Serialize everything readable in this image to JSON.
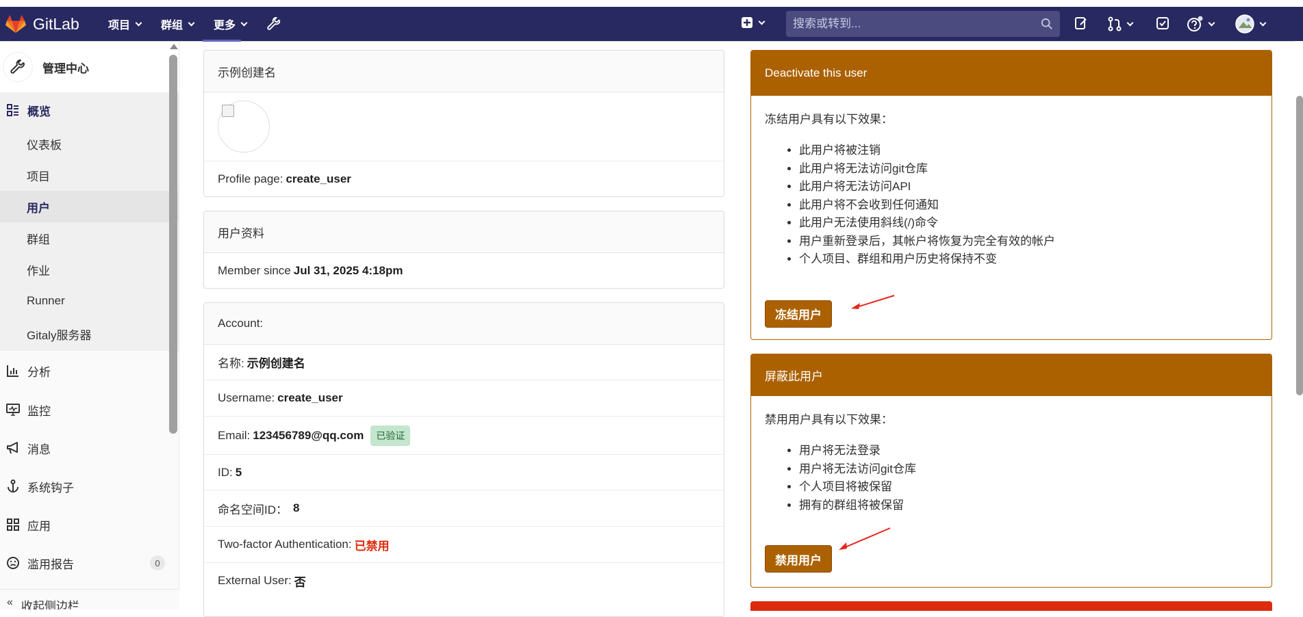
{
  "nav": {
    "brand": "GitLab",
    "menu": [
      "项目",
      "群组",
      "更多"
    ],
    "search_placeholder": "搜索或转到..."
  },
  "sidebar": {
    "title": "管理中心",
    "overview": "概览",
    "overview_items": [
      "仪表板",
      "项目",
      "用户",
      "群组",
      "作业",
      "Runner",
      "Gitaly服务器"
    ],
    "active_item": "用户",
    "items": [
      {
        "label": "分析",
        "icon": "chart-icon"
      },
      {
        "label": "监控",
        "icon": "monitor-icon"
      },
      {
        "label": "消息",
        "icon": "megaphone-icon"
      },
      {
        "label": "系统钩子",
        "icon": "anchor-icon"
      },
      {
        "label": "应用",
        "icon": "apps-icon"
      },
      {
        "label": "滥用报告",
        "icon": "smiley-icon",
        "badge": "0"
      }
    ],
    "collapse": "收起侧边栏"
  },
  "profile_card": {
    "header": "示例创建名",
    "profile_label": "Profile page:",
    "profile_value": "create_user"
  },
  "info_card": {
    "header": "用户资料",
    "member_label": "Member since",
    "member_value": "Jul 31, 2025 4:18pm"
  },
  "account_card": {
    "header": "Account:",
    "name_label": "名称:",
    "name_value": "示例创建名",
    "username_label": "Username:",
    "username_value": "create_user",
    "email_label": "Email:",
    "email_value": "123456789@qq.com",
    "verified": "已验证",
    "id_label": "ID:",
    "id_value": "5",
    "ns_label": "命名空间ID：",
    "ns_value": "8",
    "tfa_label": "Two-factor Authentication:",
    "tfa_value": "已禁用",
    "ext_label": "External User:",
    "ext_value": "否"
  },
  "deactivate_card": {
    "header": "Deactivate this user",
    "intro": "冻结用户具有以下效果：",
    "effects": [
      "此用户将被注销",
      "此用户将无法访问git仓库",
      "此用户将无法访问API",
      "此用户将不会收到任何通知",
      "此用户无法使用斜线(/)命令",
      "用户重新登录后，其帐户将恢复为完全有效的帐户",
      "个人项目、群组和用户历史将保持不变"
    ],
    "button": "冻结用户"
  },
  "block_card": {
    "header": "屏蔽此用户",
    "intro": "禁用用户具有以下效果：",
    "effects": [
      "用户将无法登录",
      "用户将无法访问git仓库",
      "个人项目将被保留",
      "拥有的群组将被保留"
    ],
    "button": "禁用用户"
  },
  "colors": {
    "navbar": "#292961",
    "warning": "#ab6100",
    "danger": "#dd2b0e",
    "annotation_arrow": "#e8261b"
  }
}
